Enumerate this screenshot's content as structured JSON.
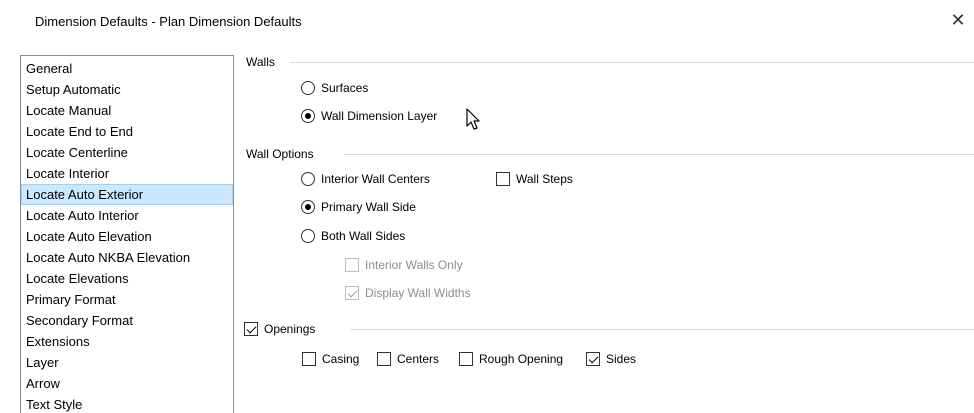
{
  "window": {
    "title": "Dimension Defaults - Plan Dimension Defaults",
    "close_glyph": "✕"
  },
  "sidebar": {
    "items": [
      {
        "label": "General"
      },
      {
        "label": "Setup Automatic"
      },
      {
        "label": "Locate Manual"
      },
      {
        "label": "Locate End to End"
      },
      {
        "label": "Locate Centerline"
      },
      {
        "label": "Locate Interior"
      },
      {
        "label": "Locate Auto Exterior",
        "selected": true
      },
      {
        "label": "Locate Auto Interior"
      },
      {
        "label": "Locate Auto Elevation"
      },
      {
        "label": "Locate Auto NKBA Elevation"
      },
      {
        "label": "Locate Elevations"
      },
      {
        "label": "Primary Format"
      },
      {
        "label": "Secondary Format"
      },
      {
        "label": "Extensions"
      },
      {
        "label": "Layer"
      },
      {
        "label": "Arrow"
      },
      {
        "label": "Text Style"
      }
    ]
  },
  "walls": {
    "label": "Walls",
    "surfaces": {
      "label": "Surfaces",
      "selected": false
    },
    "wall_dimension_layer": {
      "label": "Wall Dimension Layer",
      "selected": true
    }
  },
  "wall_options": {
    "label": "Wall Options",
    "interior_wall_centers": {
      "label": "Interior Wall Centers",
      "selected": false
    },
    "wall_steps": {
      "label": "Wall Steps",
      "checked": false
    },
    "primary_wall_side": {
      "label": "Primary Wall Side",
      "selected": true
    },
    "both_wall_sides": {
      "label": "Both Wall Sides",
      "selected": false
    },
    "interior_walls_only": {
      "label": "Interior Walls Only",
      "checked": false,
      "disabled": true
    },
    "display_wall_widths": {
      "label": "Display Wall Widths",
      "checked": true,
      "disabled": true
    }
  },
  "openings": {
    "label": "Openings",
    "checked": true,
    "casing": {
      "label": "Casing",
      "checked": false
    },
    "centers": {
      "label": "Centers",
      "checked": false
    },
    "rough_opening": {
      "label": "Rough Opening",
      "checked": false
    },
    "sides": {
      "label": "Sides",
      "checked": true
    }
  }
}
